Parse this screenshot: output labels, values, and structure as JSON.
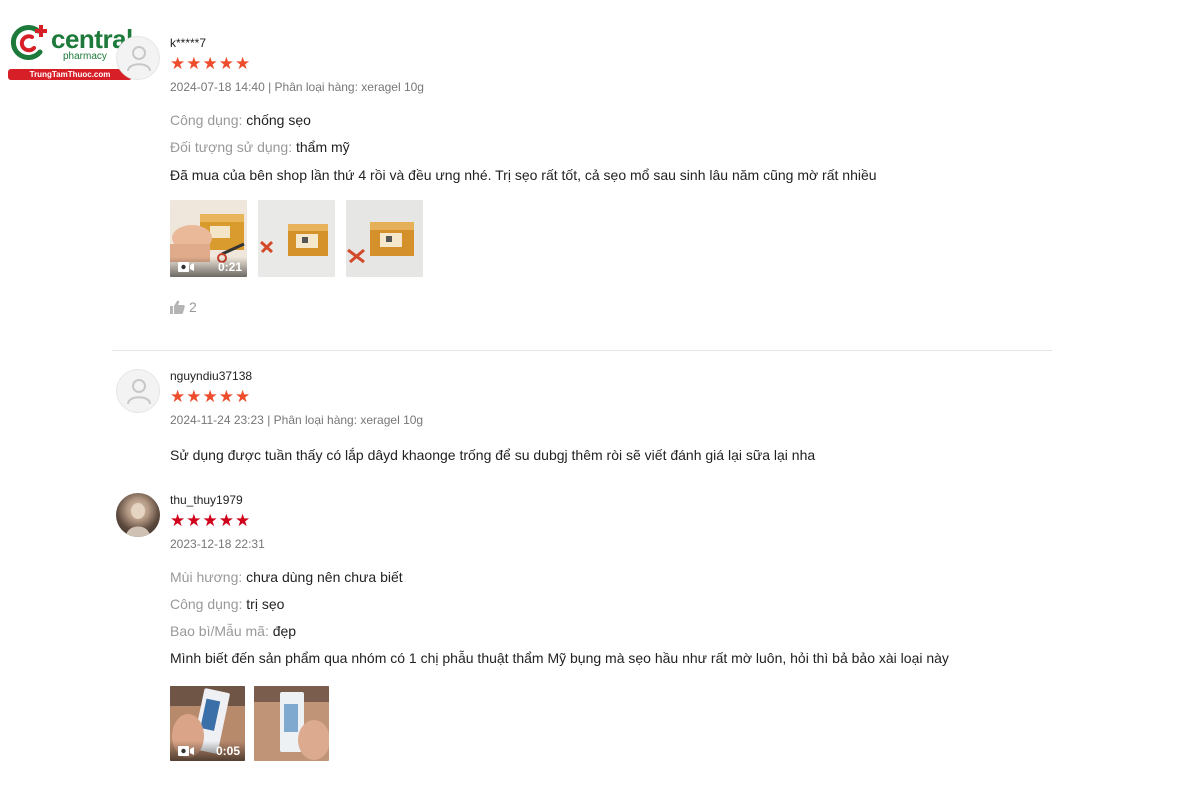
{
  "brand": {
    "name": "central",
    "sub": "pharmacy",
    "site": "TrungTamThuoc.com",
    "colors": {
      "green": "#1d7a3a",
      "red": "#d61f26"
    }
  },
  "reviews": [
    {
      "username": "k*****7",
      "rating": 5,
      "star_color": "#ee4d2d",
      "meta": "2024-07-18 14:40 | Phân loại hàng: xeragel 10g",
      "attributes": [
        {
          "label": "Công dụng:",
          "value": "chống sẹo"
        },
        {
          "label": "Đối tượng sử dụng:",
          "value": "thẩm mỹ"
        }
      ],
      "text": "Đã mua của bên shop lần thứ 4 rồi và đều ưng nhé. Trị sẹo rất tốt, cả sẹo mổ sau sinh lâu năm cũng mờ rất nhiều",
      "media": [
        {
          "type": "video",
          "duration": "0:21"
        },
        {
          "type": "image"
        },
        {
          "type": "image"
        }
      ],
      "likes": "2"
    },
    {
      "username": "nguyndiu37138",
      "rating": 5,
      "star_color": "#ee4d2d",
      "meta": "2024-11-24 23:23 | Phân loại hàng: xeragel 10g",
      "text": "Sử dụng được tuần thấy có lắp dâyd khaonge trống để su dubgj thêm ròi sẽ viết đánh giá lại sữa lại nha"
    },
    {
      "username": "thu_thuy1979",
      "rating": 5,
      "star_color": "#d0011b",
      "meta": "2023-12-18 22:31",
      "attributes": [
        {
          "label": "Mùi hương:",
          "value": "chưa dùng nên chưa biết"
        },
        {
          "label": "Công dụng:",
          "value": "trị sẹo"
        },
        {
          "label": "Bao bì/Mẫu mã:",
          "value": "đẹp"
        }
      ],
      "text": "Mình biết đến sản phẩm qua nhóm có 1 chị phẫu thuật thẩm Mỹ bụng mà sẹo hầu như rất mờ luôn, hỏi thì bả bảo xài loại này",
      "media": [
        {
          "type": "video",
          "duration": "0:05"
        },
        {
          "type": "image"
        }
      ]
    }
  ]
}
